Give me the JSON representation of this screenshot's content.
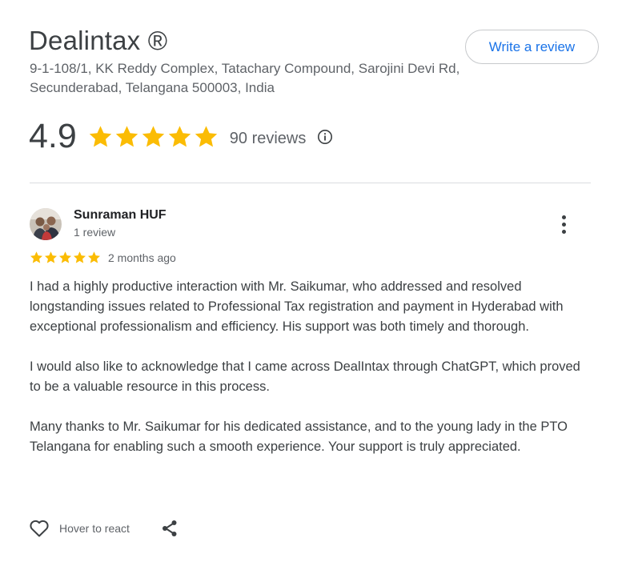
{
  "business": {
    "name": "Dealintax ®",
    "address": "9-1-108/1, KK Reddy Complex, Tatachary Compound, Sarojini Devi Rd, Secunderabad, Telangana 500003, India",
    "write_review_label": "Write a review"
  },
  "summary": {
    "rating": "4.9",
    "stars": 5,
    "review_count": "90 reviews",
    "info_icon": "info-icon"
  },
  "colors": {
    "star": "#fbbc04",
    "link": "#1a73e8",
    "text_primary": "#202124",
    "text_secondary": "#5f6368"
  },
  "review": {
    "author": "Sunraman HUF",
    "author_meta": "1 review",
    "stars": 5,
    "date": "2 months ago",
    "paragraphs": [
      "I had a highly productive interaction with Mr. Saikumar, who addressed and resolved longstanding issues related to Professional Tax registration and payment in Hyderabad with exceptional professionalism and efficiency. His support was both timely and thorough.",
      "I would also like to acknowledge that I came across DealIntax through ChatGPT, which proved to be a valuable resource in this process.",
      "Many thanks to Mr. Saikumar for his dedicated assistance, and to the young lady in the PTO Telangana for enabling such a smooth experience. Your support is truly appreciated."
    ],
    "more_icon": "more-vert-icon"
  },
  "actions": {
    "react_label": "Hover to react",
    "react_icon": "heart-icon",
    "share_icon": "share-icon"
  }
}
